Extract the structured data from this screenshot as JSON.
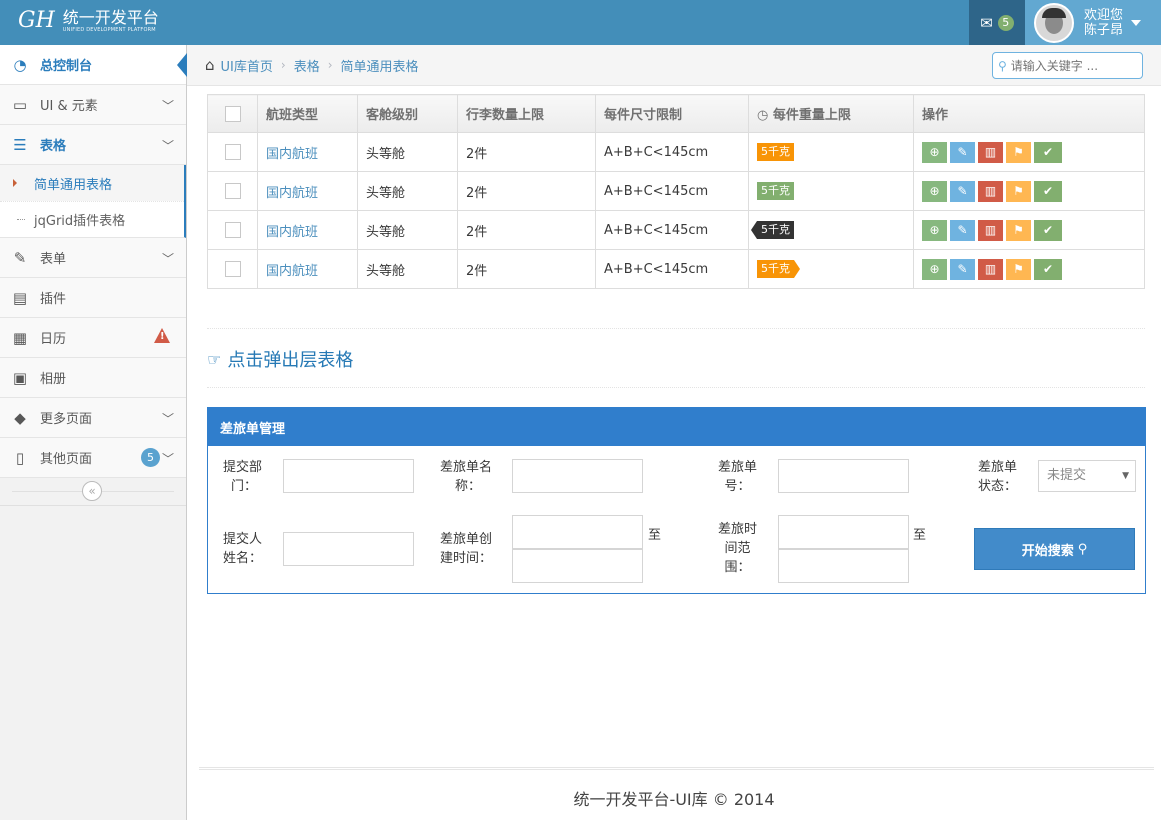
{
  "header": {
    "brand_logo": "GH",
    "brand_title": "统一开发平台",
    "brand_subtitle": "UNIFIED DEVELOPMENT PLATFORM",
    "message_count": "5",
    "welcome": "欢迎您",
    "user_name": "陈子昂"
  },
  "sidebar": {
    "items": [
      {
        "label": "总控制台",
        "icon": "dashboard-icon"
      },
      {
        "label": "UI & 元素",
        "icon": "desktop-icon"
      },
      {
        "label": "表格",
        "icon": "list-icon"
      },
      {
        "label": "表单",
        "icon": "edit-icon"
      },
      {
        "label": "插件",
        "icon": "list-alt-icon"
      },
      {
        "label": "日历",
        "icon": "calendar-icon"
      },
      {
        "label": "相册",
        "icon": "picture-icon"
      },
      {
        "label": "更多页面",
        "icon": "tag-icon"
      },
      {
        "label": "其他页面",
        "icon": "file-icon",
        "badge": "5"
      }
    ],
    "submenu": [
      {
        "label": "简单通用表格"
      },
      {
        "label": "jqGrid插件表格"
      }
    ]
  },
  "breadcrumb": {
    "home": "UI库首页",
    "parent": "表格",
    "current": "简单通用表格"
  },
  "search": {
    "placeholder": "请输入关键字 ..."
  },
  "table": {
    "headers": [
      "航班类型",
      "客舱级别",
      "行李数量上限",
      "每件尺寸限制",
      "每件重量上限",
      "操作"
    ],
    "rows": [
      {
        "type": "国内航班",
        "cabin": "头等舱",
        "count": "2件",
        "size": "A+B+C<145cm",
        "weight": "5千克",
        "tag_color": "#f89406"
      },
      {
        "type": "国内航班",
        "cabin": "头等舱",
        "count": "2件",
        "size": "A+B+C<145cm",
        "weight": "5千克",
        "tag_color": "#82af6f"
      },
      {
        "type": "国内航班",
        "cabin": "头等舱",
        "count": "2件",
        "size": "A+B+C<145cm",
        "weight": "5千克",
        "tag_color": "#333333"
      },
      {
        "type": "国内航班",
        "cabin": "头等舱",
        "count": "2件",
        "size": "A+B+C<145cm",
        "weight": "5千克",
        "tag_color": "#f89406"
      }
    ]
  },
  "section": {
    "title": "点击弹出层表格"
  },
  "form": {
    "title": "差旅单管理",
    "dept_label_1": "提交部",
    "dept_label_2": "门：",
    "name_label_1": "差旅单名",
    "name_label_2": "称：",
    "no_label_1": "差旅单",
    "no_label_2": "号：",
    "status_label_1": "差旅单",
    "status_label_2": "状态：",
    "status_value": "未提交",
    "submitter_label_1": "提交人",
    "submitter_label_2": "姓名：",
    "created_label_1": "差旅单创",
    "created_label_2": "建时间：",
    "trip_label_1": "差旅时",
    "trip_label_2": "间范",
    "trip_label_3": "围：",
    "to": "至",
    "search_button": "开始搜索"
  },
  "footer": {
    "text": "统一开发平台-UI库 © 2014"
  }
}
